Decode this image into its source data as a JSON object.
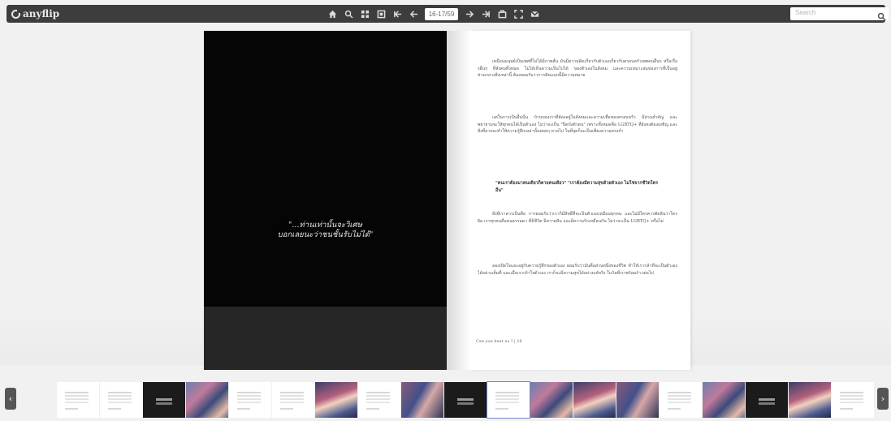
{
  "app": {
    "logo_text": "anyflip"
  },
  "toolbar": {
    "page_indicator": "16-17/59",
    "search_placeholder": "Search",
    "icons": [
      "home-icon",
      "zoom-icon",
      "thumbnails-icon",
      "single-page-icon",
      "first-page-icon",
      "previous-page-icon",
      "next-page-icon",
      "last-page-icon",
      "share-icon",
      "fullscreen-icon",
      "email-icon"
    ]
  },
  "left_page": {
    "quote_line1": "\"...ท่านเท่านั้นจะวิเศษ",
    "quote_line2": "บอกเลยนะว่าชนชั้นรับไม่ได้\""
  },
  "right_page": {
    "paragraphs": [
      "เหมือนมนุษย์เป็นเพศที่ไม่ได้มีภาพสั้น มันมีความคิดเกี่ยวกับตัวเองเกี่ยวกับครอบครัวเพศคนอื่นๆ หรือเรื่องอื่นๆ ที่สังคมทั้งหมด ไม่ได้เห็นความเป็นไปได้ ของตัวเองในสังคม และความเหมาะสมของการที่เป็นอยู่ ท่ามกลางสิ่งเหล่านี้ ต้องยอมรับว่าการคิดแบบนี้มีความหมาย",
      "แต่ในการเป็นอื่นนั้น บ้านของเราที่ต้องอยู่ในสังคมและความเชื่อของครอบครัว มีส่วนสำคัญ และพยายามจะให้ทุกคนได้เป็นตัวเอง ไม่ว่าจะเป็น \"ปิดบังตัวตน\" เพราะทั้งหมดคือ LGBTQ+ ที่ยังคงต้องเผชิญ และสิ่งที่อาจจะทำให้ความรู้สึกเหล่านั้นค่อยๆ หายไป ในที่สุดก็จะเป็นเพียงความทรงจำ",
      "\"คนเราต้องมาคนเดียวก็ตายคนเดียว\" \"เราต้องมีความสุขด้วยตัวเอง ไม่ใช่จากชีวิตใครอื่น\"",
      "สิ่งที่เราควรเป็นคือ การยอมรับว่าเราก็มีสิทธิ์ที่จะเป็นตัวเองเหมือนทุกคน และไม่มีใครควรตัดสินว่าใครผิด เราทุกคนคือคนธรรมดา ที่มีชีวิต มีความฝัน และมีความรักเหมือนกัน ไม่ว่าจะเป็น LGBTQ+ หรือไม่",
      "ลองเปิดใจและอยู่กับความรู้สึกของตัวเอง ยอมรับว่ามันคือส่วนหนึ่งของชีวิต ทำให้เรากล้าที่จะเป็นตัวเองได้อย่างเต็มที่ และเมื่อเราเข้าใจตัวเอง เราก็จะมีความสุขได้อย่างแท้จริง ในวันที่เราพร้อมก้าวต่อไป"
    ],
    "footer": "Can you hear us ? | 16"
  },
  "thumbnails": {
    "prev_label": "‹",
    "next_label": "›",
    "items": [
      {
        "kind": "light"
      },
      {
        "kind": "light"
      },
      {
        "kind": "dark"
      },
      {
        "kind": "art"
      },
      {
        "kind": "light"
      },
      {
        "kind": "light"
      },
      {
        "kind": "art2"
      },
      {
        "kind": "light"
      },
      {
        "kind": "art3"
      },
      {
        "kind": "dark"
      },
      {
        "kind": "light",
        "selected": true
      },
      {
        "kind": "art"
      },
      {
        "kind": "art2"
      },
      {
        "kind": "art3"
      },
      {
        "kind": "light"
      },
      {
        "kind": "art"
      },
      {
        "kind": "dark"
      },
      {
        "kind": "art2"
      },
      {
        "kind": "light"
      }
    ]
  },
  "colors": {
    "toolbar_bg": "#3d3d3d",
    "background": "#f1f1f1",
    "selected_outline": "#6f86c9"
  }
}
